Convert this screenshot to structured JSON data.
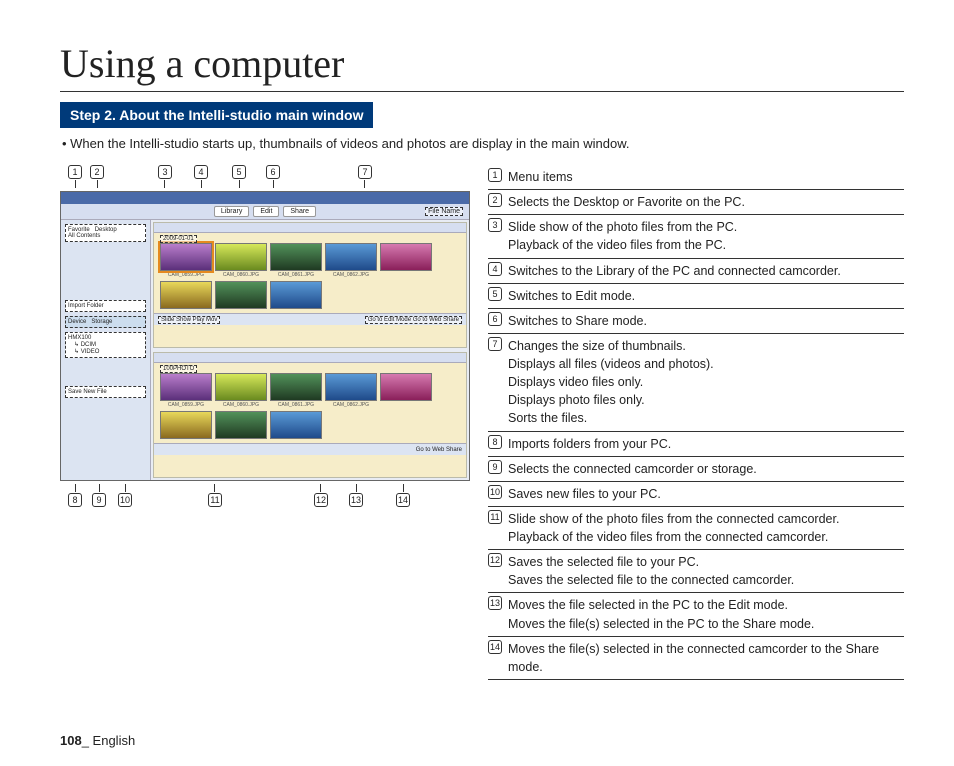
{
  "title": "Using a computer",
  "step_heading": "Step 2. About the Intelli-studio main window",
  "bullet": "•  When the Intelli-studio starts up, thumbnails of videos and photos are display in the main window.",
  "legend": [
    {
      "n": "1",
      "text": "Menu items"
    },
    {
      "n": "2",
      "text": "Selects the Desktop or Favorite on the PC."
    },
    {
      "n": "3",
      "text": "Slide show of the photo files from the PC.\nPlayback of the video files from the PC."
    },
    {
      "n": "4",
      "text": "Switches to the Library of the PC and connected camcorder."
    },
    {
      "n": "5",
      "text": "Switches to Edit mode."
    },
    {
      "n": "6",
      "text": "Switches to Share mode."
    },
    {
      "n": "7",
      "text": "Changes the size of thumbnails.\nDisplays all files (videos and photos).\nDisplays video files only.\nDisplays photo files only.\nSorts the files."
    },
    {
      "n": "8",
      "text": "Imports folders from your PC."
    },
    {
      "n": "9",
      "text": "Selects the connected camcorder or storage."
    },
    {
      "n": "10",
      "text": "Saves new files to your PC."
    },
    {
      "n": "11",
      "text": "Slide show of the photo files from the connected camcorder.\nPlayback of the video files from the connected camcorder."
    },
    {
      "n": "12",
      "text": "Saves the selected file to your PC.\nSaves the selected file to the connected camcorder."
    },
    {
      "n": "13",
      "text": "Moves the file selected in the PC to the Edit mode.\nMoves the file(s) selected in the PC to the Share mode."
    },
    {
      "n": "14",
      "text": "Moves the file(s) selected in the connected camcorder to the Share mode."
    }
  ],
  "screenshot": {
    "menu_tabs": [
      "Library",
      "Edit",
      "Share"
    ],
    "sidebar_pc": {
      "favorite": "Favorite",
      "desktop": "Desktop",
      "all": "All Contents"
    },
    "import_folder": "Import Folder",
    "sidebar_device": {
      "device": "Device",
      "storage": "Storage",
      "model": "HMX100",
      "dcim": "DCIM",
      "video": "VIDEO"
    },
    "save_new": "Save New File",
    "folder_date": "2009-01-01",
    "folder_photo": "100PHOTO",
    "strip_pc_left": "Slide Show  Play Mov",
    "strip_pc_right": "Go to Edit Mode   Go to Web Share",
    "strip_cam_right": "Go to Web Share",
    "thumb_labels": [
      "CAM_0859.JPG",
      "CAM_0860.JPG",
      "CAM_0861.JPG",
      "CAM_0862.JPG"
    ],
    "top_callouts": [
      "1",
      "2",
      "3",
      "4",
      "5",
      "6",
      "7"
    ],
    "bottom_callouts": [
      "8",
      "9",
      "10",
      "11",
      "12",
      "13",
      "14"
    ],
    "filter_label": "File Name"
  },
  "footer_page": "108",
  "footer_lang": "_ English"
}
